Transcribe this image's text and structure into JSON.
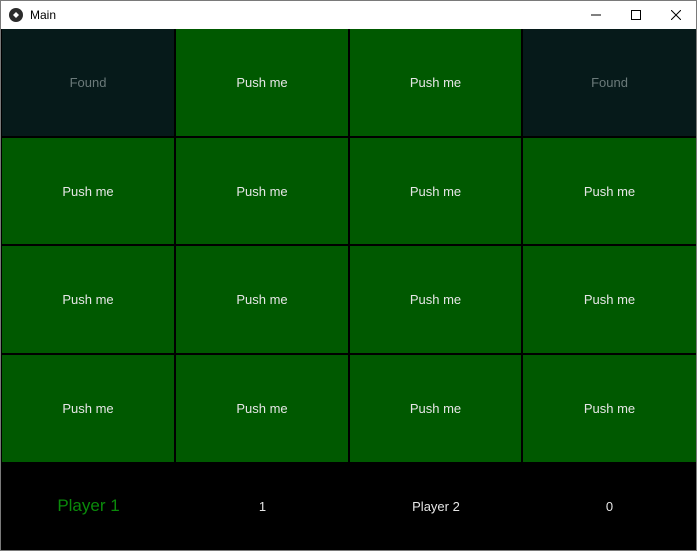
{
  "window": {
    "title": "Main"
  },
  "grid": {
    "cells": [
      {
        "label": "Found",
        "state": "found"
      },
      {
        "label": "Push me",
        "state": "push"
      },
      {
        "label": "Push me",
        "state": "push"
      },
      {
        "label": "Found",
        "state": "found"
      },
      {
        "label": "Push me",
        "state": "push"
      },
      {
        "label": "Push me",
        "state": "push"
      },
      {
        "label": "Push me",
        "state": "push"
      },
      {
        "label": "Push me",
        "state": "push"
      },
      {
        "label": "Push me",
        "state": "push"
      },
      {
        "label": "Push me",
        "state": "push"
      },
      {
        "label": "Push me",
        "state": "push"
      },
      {
        "label": "Push me",
        "state": "push"
      },
      {
        "label": "Push me",
        "state": "push"
      },
      {
        "label": "Push me",
        "state": "push"
      },
      {
        "label": "Push me",
        "state": "push"
      },
      {
        "label": "Push me",
        "state": "push"
      }
    ]
  },
  "scoreboard": {
    "player1_label": "Player 1",
    "player1_score": "1",
    "player2_label": "Player 2",
    "player2_score": "0",
    "active_player": "Player 1"
  },
  "colors": {
    "button_green": "#005900",
    "found_bg": "#061a1a",
    "active_player_text": "#0a8a0a"
  }
}
